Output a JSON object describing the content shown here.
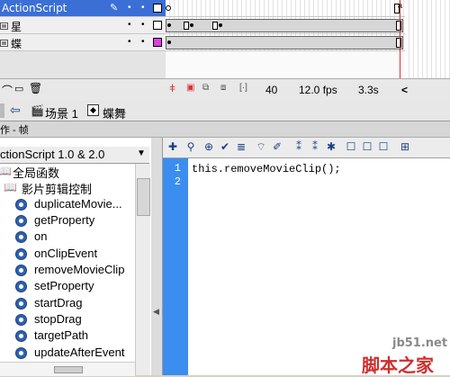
{
  "timeline": {
    "layers": [
      {
        "name": "ActionScript",
        "selected": true
      },
      {
        "name": "星",
        "selected": false
      },
      {
        "name": "蝶",
        "selected": false
      }
    ],
    "status": {
      "frame": "40",
      "fps": "12.0 fps",
      "time": "3.3s",
      "scroll_left": "<"
    }
  },
  "scene_bar": {
    "scene_label": "场景 1",
    "symbol_label": "蝶舞"
  },
  "panel": {
    "title": "作 - 帧"
  },
  "toolbox": {
    "selector": "ctionScript 1.0 & 2.0",
    "category": "全局函数",
    "subcategory": "影片剪辑控制",
    "items": [
      "duplicateMovie...",
      "getProperty",
      "on",
      "onClipEvent",
      "removeMovieClip",
      "setProperty",
      "startDrag",
      "stopDrag",
      "targetPath",
      "updateAfterEvent"
    ]
  },
  "editor": {
    "line_numbers": [
      "1",
      "2"
    ],
    "code_lines": [
      "this.removeMovieClip();"
    ]
  },
  "watermark": {
    "site": "jb51.net",
    "brand": "脚本之家"
  },
  "colors": {
    "selected_layer": "#3b6fd6",
    "gutter": "#3c8df0",
    "playhead": "#dd3333",
    "layer_color_sq": "#e040e0"
  }
}
